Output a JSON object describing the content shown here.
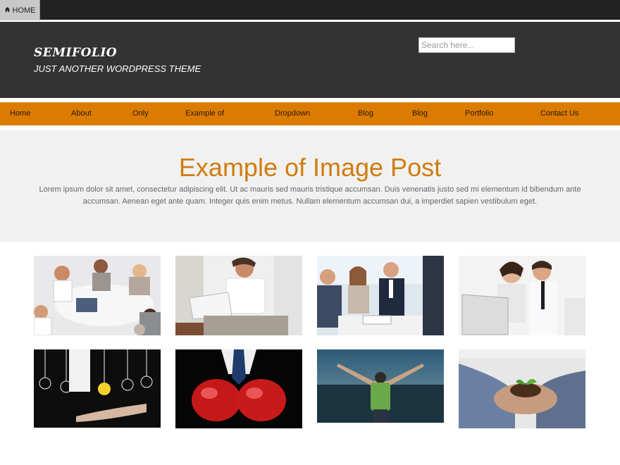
{
  "topbar": {
    "home_label": "HOME",
    "home_icon": "home-icon"
  },
  "header": {
    "site_title": "SEMIFOLIO",
    "tagline": "JUST ANOTHER WORDPRESS THEME",
    "search_placeholder": "Search here..."
  },
  "nav": {
    "items": [
      {
        "label": "Home"
      },
      {
        "label": "About"
      },
      {
        "label": "Only"
      },
      {
        "label": "Example of"
      },
      {
        "label": "Dropdown"
      },
      {
        "label": "Blog"
      },
      {
        "label": "Blog"
      },
      {
        "label": "Portfolio"
      },
      {
        "label": "Contact Us"
      }
    ],
    "bg_color": "#db7b02"
  },
  "hero": {
    "title": "Example of Image Post",
    "text": "Lorem ipsum dolor sit amet, consectetur adipiscing elit. Ut ac mauris sed mauris tristique accumsan. Duis venenatis justo sed mi elementum id bibendum ante accumsan. Aenean eget ante quam. Integer quis enim metus. Nullam elementum accumsan dui, a imperdiet sapien vestibulum eget.",
    "title_color": "#d07c0e"
  },
  "gallery": [
    {
      "subject": "business-meeting-overhead"
    },
    {
      "subject": "man-with-laptop"
    },
    {
      "subject": "office-team-meeting"
    },
    {
      "subject": "couple-with-laptop"
    },
    {
      "subject": "lightbulbs-idea"
    },
    {
      "subject": "boxing-gloves"
    },
    {
      "subject": "man-celebrating-field"
    },
    {
      "subject": "hands-holding-plant"
    }
  ]
}
